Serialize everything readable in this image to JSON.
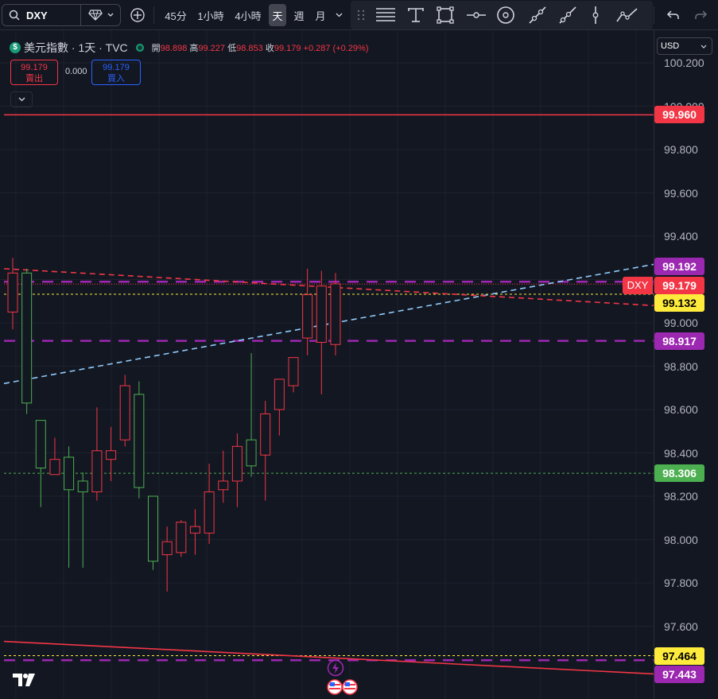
{
  "toolbar": {
    "symbol": "DXY",
    "intervals": [
      "45分",
      "1小時",
      "4小時",
      "天",
      "週",
      "月"
    ],
    "active_interval": "天"
  },
  "legend": {
    "title": "美元指數 · 1天 · TVC",
    "open_label": "開",
    "open": "98.898",
    "high_label": "高",
    "high": "99.227",
    "low_label": "低",
    "low": "98.853",
    "close_label": "收",
    "close": "99.179",
    "change": "+0.287 (+0.29%)"
  },
  "trade": {
    "sell_price": "99.179",
    "sell_label": "賣出",
    "spread": "0.000",
    "buy_price": "99.179",
    "buy_label": "買入"
  },
  "currency": "USD",
  "axis_labels": [
    "100.200",
    "100.000",
    "99.800",
    "99.600",
    "99.400",
    "99.000",
    "98.800",
    "98.600",
    "98.400",
    "98.200",
    "98.000",
    "97.800",
    "97.600"
  ],
  "price_tags": [
    {
      "label": "99.960",
      "color": "#f23645",
      "text_color": "#ffffff"
    },
    {
      "label": "99.192",
      "color": "#9c27b0",
      "text_color": "#ffffff"
    },
    {
      "label": "99.179",
      "color": "#f23645",
      "text_color": "#ffffff"
    },
    {
      "label": "99.132",
      "color": "#ffeb3b",
      "text_color": "#000000"
    },
    {
      "label": "98.917",
      "color": "#9c27b0",
      "text_color": "#ffffff"
    },
    {
      "label": "98.306",
      "color": "#4caf50",
      "text_color": "#ffffff"
    },
    {
      "label": "97.464",
      "color": "#ffeb3b",
      "text_color": "#000000"
    },
    {
      "label": "97.443",
      "color": "#9c27b0",
      "text_color": "#ffffff"
    }
  ],
  "symbol_tag": "DXY",
  "colors": {
    "up": "#f23645",
    "down": "#4caf50",
    "background": "#131722"
  },
  "chart_data": {
    "type": "candlestick",
    "candles": [
      {
        "o": 99.05,
        "h": 99.3,
        "l": 98.97,
        "c": 99.23
      },
      {
        "o": 99.23,
        "h": 99.25,
        "l": 98.58,
        "c": 98.63
      },
      {
        "o": 98.55,
        "h": 98.55,
        "l": 98.15,
        "c": 98.33
      },
      {
        "o": 98.3,
        "h": 98.47,
        "l": 98.3,
        "c": 98.37
      },
      {
        "o": 98.38,
        "h": 98.43,
        "l": 97.87,
        "c": 98.23
      },
      {
        "o": 98.27,
        "h": 98.31,
        "l": 97.87,
        "c": 98.22
      },
      {
        "o": 98.22,
        "h": 98.61,
        "l": 98.18,
        "c": 98.41
      },
      {
        "o": 98.37,
        "h": 98.52,
        "l": 98.27,
        "c": 98.41
      },
      {
        "o": 98.46,
        "h": 98.76,
        "l": 98.43,
        "c": 98.71
      },
      {
        "o": 98.67,
        "h": 98.73,
        "l": 98.19,
        "c": 98.24
      },
      {
        "o": 98.2,
        "h": 98.19,
        "l": 97.86,
        "c": 97.9
      },
      {
        "o": 97.93,
        "h": 98.06,
        "l": 97.76,
        "c": 97.99
      },
      {
        "o": 97.94,
        "h": 98.09,
        "l": 97.92,
        "c": 98.08
      },
      {
        "o": 98.03,
        "h": 98.14,
        "l": 97.93,
        "c": 98.06
      },
      {
        "o": 98.03,
        "h": 98.35,
        "l": 97.98,
        "c": 98.22
      },
      {
        "o": 98.23,
        "h": 98.41,
        "l": 98.17,
        "c": 98.27
      },
      {
        "o": 98.27,
        "h": 98.49,
        "l": 98.15,
        "c": 98.43
      },
      {
        "o": 98.46,
        "h": 98.86,
        "l": 98.29,
        "c": 98.34
      },
      {
        "o": 98.39,
        "h": 98.64,
        "l": 98.18,
        "c": 98.58
      },
      {
        "o": 98.6,
        "h": 98.68,
        "l": 98.48,
        "c": 98.74
      },
      {
        "o": 98.71,
        "h": 98.84,
        "l": 98.68,
        "c": 98.84
      },
      {
        "o": 98.93,
        "h": 99.25,
        "l": 98.85,
        "c": 99.13
      },
      {
        "o": 98.91,
        "h": 99.24,
        "l": 98.67,
        "c": 99.17
      },
      {
        "o": 98.9,
        "h": 99.23,
        "l": 98.85,
        "c": 99.18
      }
    ],
    "ylim": [
      97.4,
      100.3
    ]
  }
}
